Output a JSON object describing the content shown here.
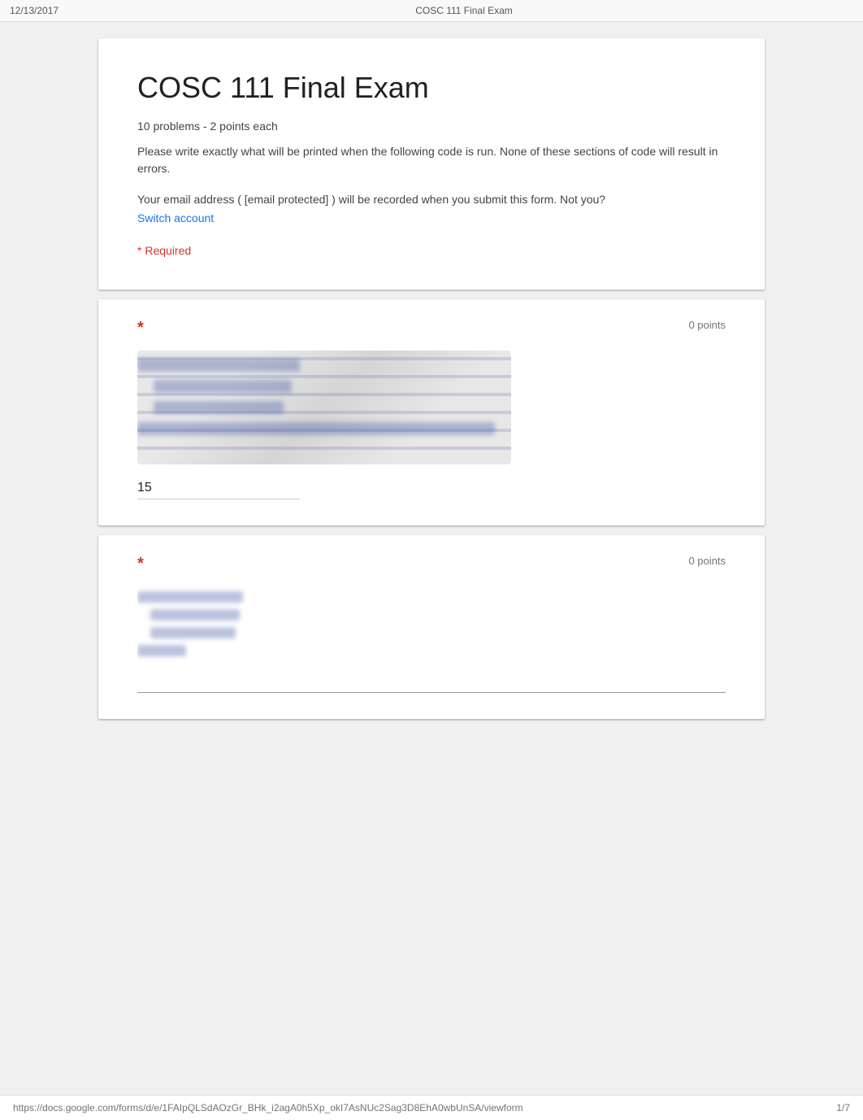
{
  "browser": {
    "date": "12/13/2017",
    "title": "COSC 111 Final Exam"
  },
  "form": {
    "title": "COSC 111 Final Exam",
    "subtitle": "10 problems - 2 points each",
    "description": "Please write exactly what will be printed when the following code is run. None of these sections of code will result in errors.",
    "email_notice": "Your email address (",
    "email_address": "[email protected]",
    "email_notice_end": ") will be recorded when you submit this form. Not you?",
    "switch_account": "Switch account",
    "required_note": "* Required"
  },
  "questions": [
    {
      "id": "q1",
      "required_star": "*",
      "points": "0 points",
      "answer_value": "15"
    },
    {
      "id": "q2",
      "required_star": "*",
      "points": "0 points",
      "answer_value": ""
    }
  ],
  "footer": {
    "url": "https://docs.google.com/forms/d/e/1FAIpQLSdAOzGr_BHk_i2agA0h5Xp_okI7AsNUc2Sag3D8EhA0wbUnSA/viewform",
    "page_indicator": "1/7"
  }
}
